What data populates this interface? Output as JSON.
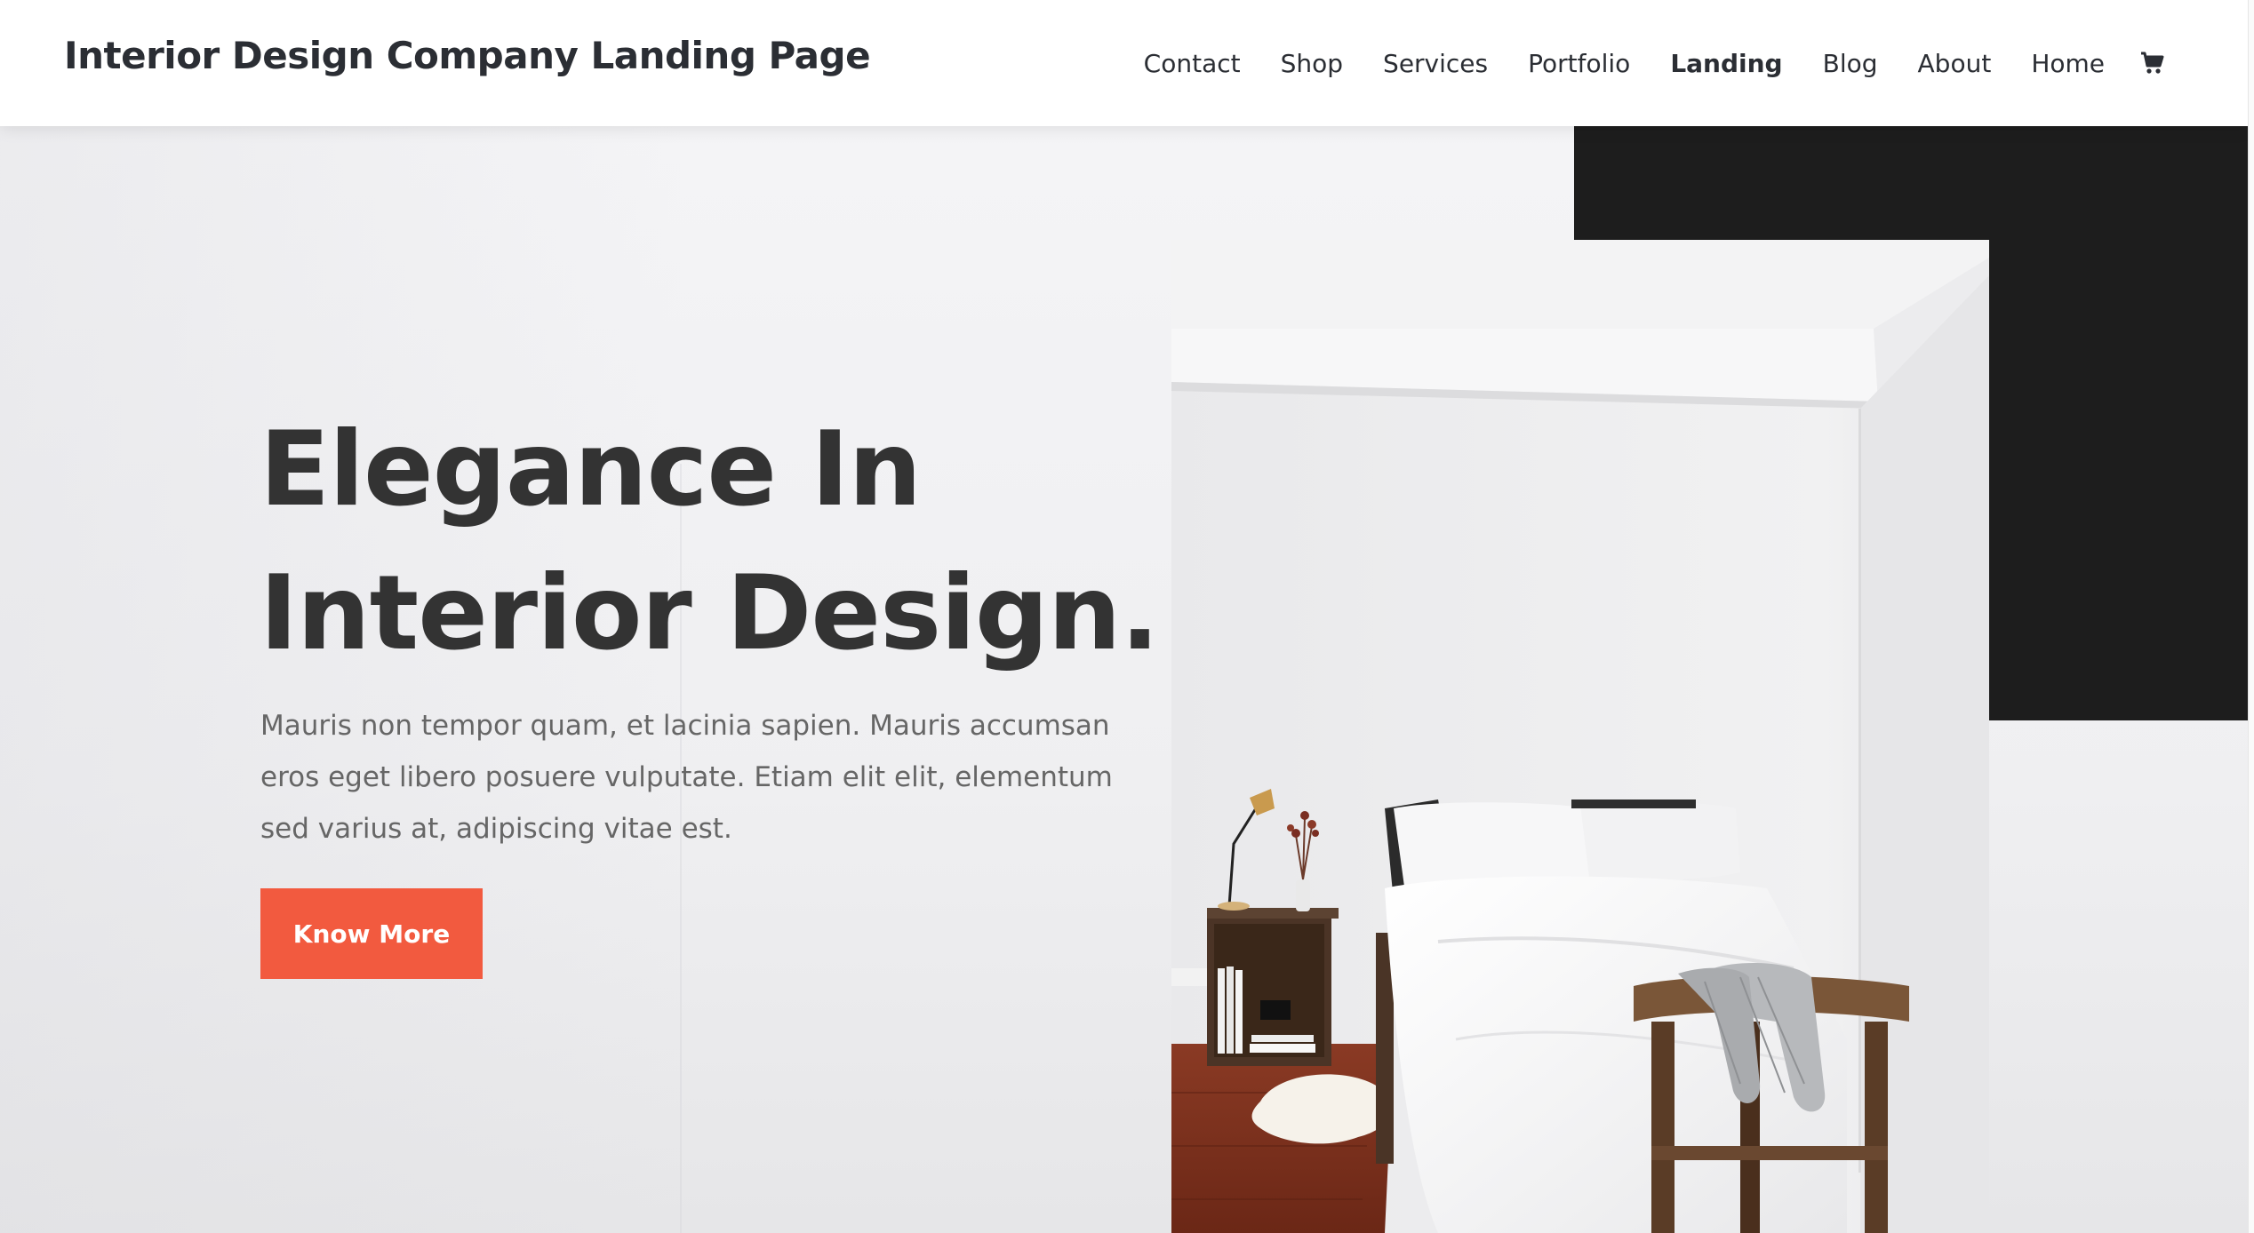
{
  "header": {
    "site_title": "Interior Design Company Landing Page",
    "nav": [
      {
        "label": "Contact",
        "active": false
      },
      {
        "label": "Shop",
        "active": false
      },
      {
        "label": "Services",
        "active": false
      },
      {
        "label": "Portfolio",
        "active": false
      },
      {
        "label": "Landing",
        "active": true
      },
      {
        "label": "Blog",
        "active": false
      },
      {
        "label": "About",
        "active": false
      },
      {
        "label": "Home",
        "active": false
      }
    ],
    "cart_icon": "shopping-cart-icon"
  },
  "hero": {
    "headline_line1": "Elegance In",
    "headline_line2": "Interior Design.",
    "lead": "Mauris non tempor quam, et lacinia sapien. Mauris accumsan eros eget libero posuere vulputate. Etiam elit elit, elementum sed varius at, adipiscing vitae est.",
    "cta_label": "Know More"
  },
  "colors": {
    "accent": "#f25a3f",
    "dark_block": "#1d1d1d",
    "heading": "#333333",
    "body_text": "#666666"
  }
}
